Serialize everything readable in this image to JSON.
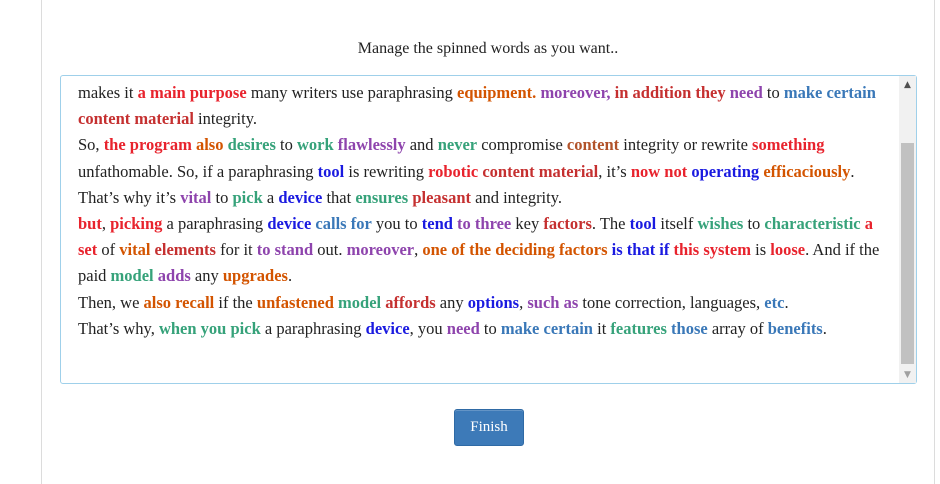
{
  "instruction": "Manage the spinned words as you want..",
  "finish_label": "Finish",
  "scrollbar": {
    "up_glyph": "▲",
    "down_glyph": "▼"
  },
  "colors": {
    "red": "#e8232d",
    "darkred": "#c53030",
    "purple": "#8e44ad",
    "blue": "#1a1ae0",
    "steel": "#3a78b8",
    "green": "#36a27a",
    "orange": "#d35400",
    "brown": "#b2532a",
    "button": "#3d7ab8"
  },
  "paragraphs": [
    [
      {
        "t": "makes it "
      },
      {
        "t": "a main purpose",
        "c": "red"
      },
      {
        "t": " many writers use paraphrasing "
      },
      {
        "t": "equipment.",
        "c": "orange"
      },
      {
        "t": " "
      },
      {
        "t": "moreover,",
        "c": "purple"
      },
      {
        "t": " "
      },
      {
        "t": "in addition they",
        "c": "darkred"
      },
      {
        "t": " "
      },
      {
        "t": "need",
        "c": "purple"
      },
      {
        "t": " to "
      },
      {
        "t": "make certain",
        "c": "steel"
      },
      {
        "t": " "
      },
      {
        "t": "content material",
        "c": "darkred"
      },
      {
        "t": " integrity."
      }
    ],
    [
      {
        "t": "So, "
      },
      {
        "t": "the program",
        "c": "red"
      },
      {
        "t": " "
      },
      {
        "t": "also",
        "c": "orange"
      },
      {
        "t": " "
      },
      {
        "t": "desires",
        "c": "green"
      },
      {
        "t": " to "
      },
      {
        "t": "work",
        "c": "green"
      },
      {
        "t": " "
      },
      {
        "t": "flawlessly",
        "c": "purple"
      },
      {
        "t": " and "
      },
      {
        "t": "never",
        "c": "green"
      },
      {
        "t": " compromise "
      },
      {
        "t": "content",
        "c": "brown"
      },
      {
        "t": " integrity or rewrite "
      },
      {
        "t": "something",
        "c": "red"
      },
      {
        "t": " unfathomable. So, if a paraphrasing "
      },
      {
        "t": "tool",
        "c": "blue"
      },
      {
        "t": " is rewriting "
      },
      {
        "t": "robotic",
        "c": "red"
      },
      {
        "t": " "
      },
      {
        "t": "content material",
        "c": "darkred"
      },
      {
        "t": ", it’s "
      },
      {
        "t": "now not",
        "c": "red"
      },
      {
        "t": " "
      },
      {
        "t": "operating",
        "c": "blue"
      },
      {
        "t": " "
      },
      {
        "t": "efficaciously",
        "c": "orange"
      },
      {
        "t": ". That’s why it’s "
      },
      {
        "t": "vital",
        "c": "purple"
      },
      {
        "t": " to "
      },
      {
        "t": "pick",
        "c": "green"
      },
      {
        "t": " a "
      },
      {
        "t": "device",
        "c": "blue"
      },
      {
        "t": " that "
      },
      {
        "t": "ensures",
        "c": "green"
      },
      {
        "t": " "
      },
      {
        "t": "pleasant",
        "c": "darkred"
      },
      {
        "t": " and integrity."
      }
    ],
    [
      {
        "t": "but",
        "c": "red"
      },
      {
        "t": ", "
      },
      {
        "t": "picking",
        "c": "red"
      },
      {
        "t": " a paraphrasing "
      },
      {
        "t": "device",
        "c": "blue"
      },
      {
        "t": " "
      },
      {
        "t": "calls for",
        "c": "steel"
      },
      {
        "t": " you to "
      },
      {
        "t": "tend",
        "c": "blue"
      },
      {
        "t": " "
      },
      {
        "t": "to three",
        "c": "purple"
      },
      {
        "t": " key "
      },
      {
        "t": "factors",
        "c": "darkred"
      },
      {
        "t": ". The "
      },
      {
        "t": "tool",
        "c": "blue"
      },
      {
        "t": " itself "
      },
      {
        "t": "wishes",
        "c": "green"
      },
      {
        "t": " to "
      },
      {
        "t": "characteristic",
        "c": "green"
      },
      {
        "t": " "
      },
      {
        "t": "a set",
        "c": "red"
      },
      {
        "t": " of "
      },
      {
        "t": "vital",
        "c": "orange"
      },
      {
        "t": " "
      },
      {
        "t": "elements",
        "c": "darkred"
      },
      {
        "t": " for it "
      },
      {
        "t": "to stand",
        "c": "purple"
      },
      {
        "t": " out. "
      },
      {
        "t": "moreover",
        "c": "purple"
      },
      {
        "t": ", "
      },
      {
        "t": "one of the deciding factors",
        "c": "orange"
      },
      {
        "t": " "
      },
      {
        "t": "is that if",
        "c": "blue"
      },
      {
        "t": " "
      },
      {
        "t": "this system",
        "c": "red"
      },
      {
        "t": " is "
      },
      {
        "t": "loose",
        "c": "red"
      },
      {
        "t": ". And if the paid "
      },
      {
        "t": "model",
        "c": "green"
      },
      {
        "t": " "
      },
      {
        "t": "adds",
        "c": "purple"
      },
      {
        "t": " any "
      },
      {
        "t": "upgrades",
        "c": "orange"
      },
      {
        "t": "."
      }
    ],
    [
      {
        "t": "Then, we "
      },
      {
        "t": "also recall",
        "c": "orange"
      },
      {
        "t": " if the "
      },
      {
        "t": "unfastened",
        "c": "orange"
      },
      {
        "t": " "
      },
      {
        "t": "model",
        "c": "green"
      },
      {
        "t": " "
      },
      {
        "t": "affords",
        "c": "darkred"
      },
      {
        "t": " any "
      },
      {
        "t": "options",
        "c": "blue"
      },
      {
        "t": ", "
      },
      {
        "t": "such as",
        "c": "purple"
      },
      {
        "t": " tone correction, languages, "
      },
      {
        "t": "etc",
        "c": "steel"
      },
      {
        "t": "."
      }
    ],
    [
      {
        "t": "That’s why, "
      },
      {
        "t": "when you pick",
        "c": "green"
      },
      {
        "t": " a paraphrasing "
      },
      {
        "t": "device",
        "c": "blue"
      },
      {
        "t": ", you "
      },
      {
        "t": "need",
        "c": "purple"
      },
      {
        "t": " to "
      },
      {
        "t": "make certain",
        "c": "steel"
      },
      {
        "t": " it "
      },
      {
        "t": "features",
        "c": "green"
      },
      {
        "t": " "
      },
      {
        "t": "those",
        "c": "steel"
      },
      {
        "t": " array of "
      },
      {
        "t": "benefits",
        "c": "steel"
      },
      {
        "t": "."
      }
    ]
  ]
}
